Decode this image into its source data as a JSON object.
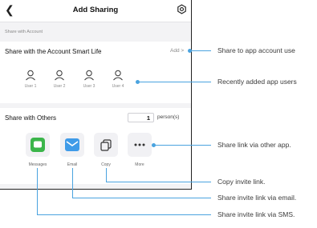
{
  "header": {
    "title": "Add Sharing"
  },
  "account_section": {
    "label": "Share with Account",
    "title": "Share with the Account Smart Life",
    "add_label": "Add >",
    "users": [
      "User 1",
      "User 2",
      "User 3",
      "User 4"
    ]
  },
  "others_section": {
    "title": "Share with Others",
    "count": "1",
    "unit": "person(s)",
    "apps": [
      {
        "label": "Messages",
        "icon": "messages-icon",
        "color": "#3bb54a"
      },
      {
        "label": "Email",
        "icon": "email-icon",
        "color": "#3f9be8"
      },
      {
        "label": "Copy",
        "icon": "copy-icon"
      },
      {
        "label": "More",
        "icon": "more-icon"
      }
    ]
  },
  "annotations": {
    "add": "Share to app account use",
    "users": "Recently added app users",
    "more": "Share link via other app.",
    "copy": "Copy invite link.",
    "email": "Share invite link via email.",
    "sms": "Share invite link via SMS."
  },
  "colors": {
    "accent": "#4aa3df",
    "messages": "#3bb54a",
    "email": "#3f9be8"
  }
}
